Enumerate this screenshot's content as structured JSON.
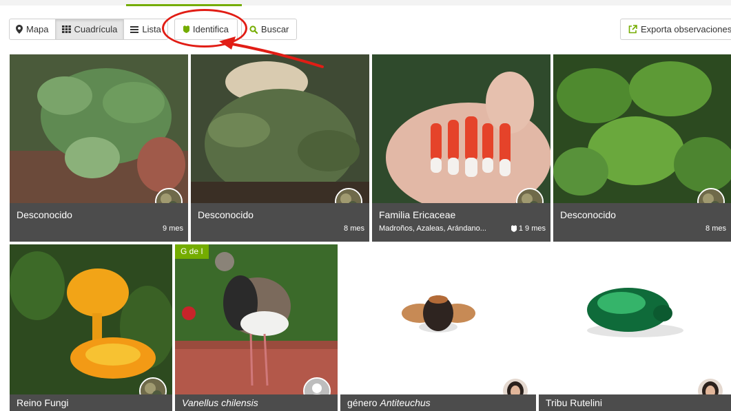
{
  "toolbar": {
    "map_label": "Mapa",
    "grid_label": "Cuadrícula",
    "list_label": "Lista",
    "identify_label": "Identifica",
    "search_label": "Buscar",
    "export_label": "Exporta observaciones"
  },
  "colors": {
    "brand": "#74ac00",
    "annotation": "#e11d15",
    "caption_bg": "#4c4c4c"
  },
  "cards": [
    {
      "title": "Desconocido",
      "time": "9 mes"
    },
    {
      "title": "Desconocido",
      "time": "8 mes"
    },
    {
      "title": "Familia Ericaceae",
      "subtitle": "Madroños, Azaleas, Arándano...",
      "id_count": "1",
      "time": "9 mes"
    },
    {
      "title": "Desconocido",
      "time": "8 mes"
    },
    {
      "title": "Reino Fungi"
    },
    {
      "title": "Vanellus chilensis",
      "badge": "G de I"
    },
    {
      "rank": "género",
      "taxon": "Antiteuchus"
    },
    {
      "title": "Tribu Rutelini"
    }
  ]
}
